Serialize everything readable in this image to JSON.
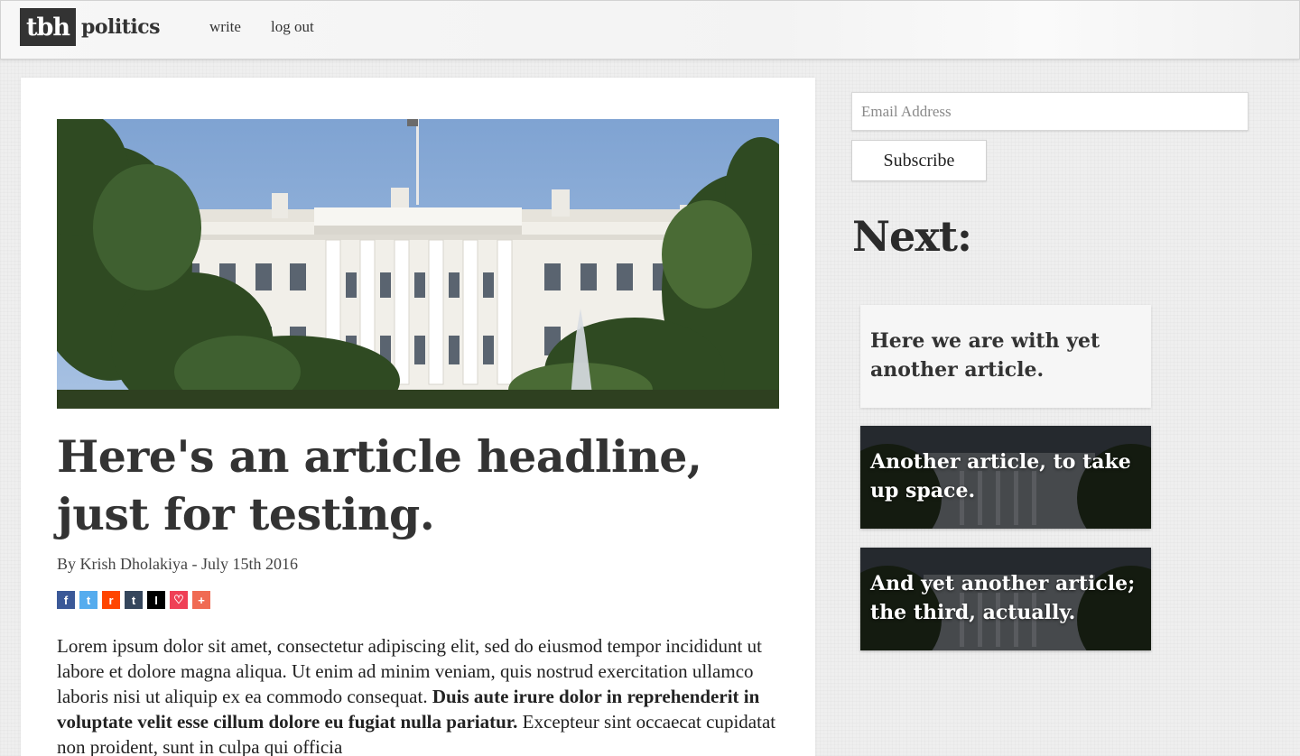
{
  "header": {
    "logo_mark": "tbh",
    "logo_word": "politics",
    "nav": [
      {
        "label": "write"
      },
      {
        "label": "log out"
      }
    ]
  },
  "article": {
    "hero_alt": "White House",
    "headline": "Here's an article headline, just for testing.",
    "byline": "By Krish Dholakiya - July 15th 2016",
    "share_buttons": [
      {
        "icon": "facebook-icon",
        "glyph": "f",
        "color": "#3b5998"
      },
      {
        "icon": "twitter-icon",
        "glyph": "t",
        "color": "#55acee"
      },
      {
        "icon": "reddit-icon",
        "glyph": "r",
        "color": "#ff4500"
      },
      {
        "icon": "tumblr-icon",
        "glyph": "t",
        "color": "#35465c"
      },
      {
        "icon": "instapaper-icon",
        "glyph": "I",
        "color": "#000000"
      },
      {
        "icon": "pocket-icon",
        "glyph": "♡",
        "color": "#ef4056"
      },
      {
        "icon": "more-icon",
        "glyph": "+",
        "color": "#f06b53"
      }
    ],
    "body_part1": "Lorem ipsum dolor sit amet, consectetur adipiscing elit, sed do eiusmod tempor incididunt ut labore et dolore magna aliqua. Ut enim ad minim veniam, quis nostrud exercitation ullamco laboris nisi ut aliquip ex ea commodo consequat. ",
    "body_bold": "Duis aute irure dolor in reprehenderit in voluptate velit esse cillum dolore eu fugiat nulla pariatur.",
    "body_part2": " Excepteur sint occaecat cupidatat non proident, sunt in culpa qui officia"
  },
  "sidebar": {
    "email_placeholder": "Email Address",
    "subscribe_label": "Subscribe",
    "next_heading": "Next:",
    "next_articles": [
      {
        "title": "Here we are with yet another article."
      },
      {
        "title": "Another article, to take up space."
      },
      {
        "title": "And yet another article; the third, actually."
      }
    ]
  }
}
